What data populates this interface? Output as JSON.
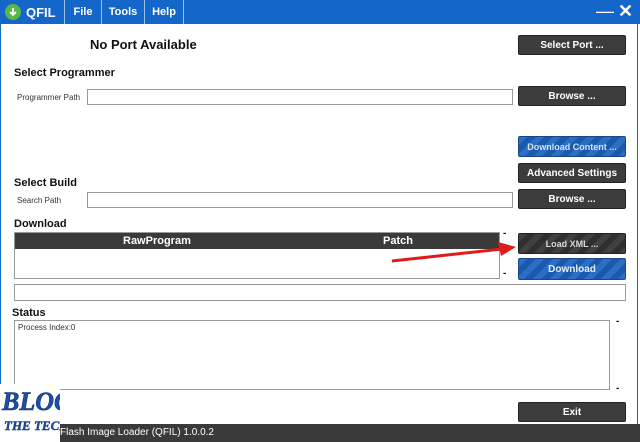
{
  "app": {
    "name": "QFIL",
    "footer": "Flash Image Loader (QFIL)   1.0.0.2"
  },
  "menu": {
    "file": "File",
    "tools": "Tools",
    "help": "Help"
  },
  "window": {
    "minimize": "—",
    "close": "✕"
  },
  "port": {
    "status": "No Port Available",
    "select_button": "Select Port ..."
  },
  "programmer": {
    "section_title": "Select Programmer",
    "path_label": "Programmer Path",
    "path_value": "",
    "browse_button": "Browse ..."
  },
  "download_content_button": "Download Content ...",
  "advanced_settings_button": "Advanced Settings",
  "build": {
    "section_title": "Select Build",
    "search_label": "Search Path",
    "search_value": "",
    "browse_button": "Browse ..."
  },
  "download": {
    "section_title": "Download",
    "columns": [
      "RawProgram",
      "Patch"
    ],
    "add_dash": "-",
    "remove_dash": "-",
    "load_xml_button": "Load XML ...",
    "download_button": "Download",
    "progress_value": ""
  },
  "status": {
    "section_title": "Status",
    "text": "Process Index:0",
    "dash_top": "-",
    "dash_bottom": "-"
  },
  "exit_button": "Exit",
  "logo": {
    "line1": "BLOG",
    "line2": "THE TECH"
  },
  "colors": {
    "titlebar": "#1467c8",
    "dark_button": "#3c3c3c",
    "accent_blue": "#2a6ec6",
    "annotation_arrow": "#e01b1b"
  }
}
